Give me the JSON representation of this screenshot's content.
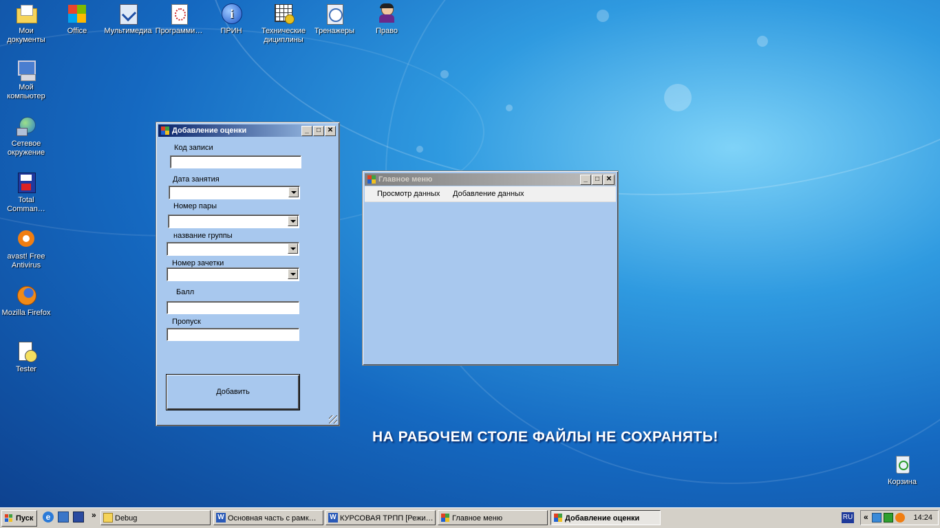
{
  "desktop": {
    "icons": [
      {
        "label": "Мои документы",
        "icon": "folder-documents-icon"
      },
      {
        "label": "Office",
        "icon": "office-logo-icon"
      },
      {
        "label": "Мультимедиа",
        "icon": "multimedia-icon"
      },
      {
        "label": "Программи…",
        "icon": "programming-icon"
      },
      {
        "label": "ПРИН",
        "icon": "info-icon"
      },
      {
        "label": "Технические дициплины",
        "icon": "technical-icon"
      },
      {
        "label": "Тренажеры",
        "icon": "trainers-icon"
      },
      {
        "label": "Право",
        "icon": "law-icon"
      },
      {
        "label": "Мой компьютер",
        "icon": "my-computer-icon"
      },
      {
        "label": "Сетевое окружение",
        "icon": "network-icon"
      },
      {
        "label": "Total Comman…",
        "icon": "total-commander-icon"
      },
      {
        "label": "avast! Free Antivirus",
        "icon": "avast-icon"
      },
      {
        "label": "Mozilla Firefox",
        "icon": "firefox-icon"
      },
      {
        "label": "Tester",
        "icon": "tester-icon"
      },
      {
        "label": "Корзина",
        "icon": "recycle-bin-icon"
      }
    ],
    "warning_text": "НА РАБОЧЕМ СТОЛЕ ФАЙЛЫ НЕ СОХРАНЯТЬ!"
  },
  "add_grade_window": {
    "title": "Добавление оценки",
    "fields": {
      "record_code": {
        "label": "Код записи",
        "value": ""
      },
      "lesson_date": {
        "label": "Дата занятия",
        "value": ""
      },
      "lesson_number": {
        "label": "Номер пары",
        "value": ""
      },
      "group_name": {
        "label": "название группы",
        "value": ""
      },
      "record_book": {
        "label": "Номер зачетки",
        "value": ""
      },
      "score": {
        "label": "Балл",
        "value": ""
      },
      "absence": {
        "label": "Пропуск",
        "value": ""
      }
    },
    "add_button": "Добавить"
  },
  "main_menu_window": {
    "title": "Главное меню",
    "menu": [
      "Просмотр данных",
      "Добавление данных"
    ]
  },
  "taskbar": {
    "start": "Пуск",
    "tasks": [
      "Debug",
      "Основная часть с рамк…",
      "КУРСОВАЯ ТРПП [Режи…",
      "Главное меню",
      "Добавление оценки"
    ],
    "active_task": "Добавление оценки",
    "language": "RU",
    "clock": "14:24"
  },
  "colors": {
    "window_bg": "#a8c8ee",
    "titlebar_active": "#0a246a",
    "desktop_blue": "#1569c1"
  }
}
